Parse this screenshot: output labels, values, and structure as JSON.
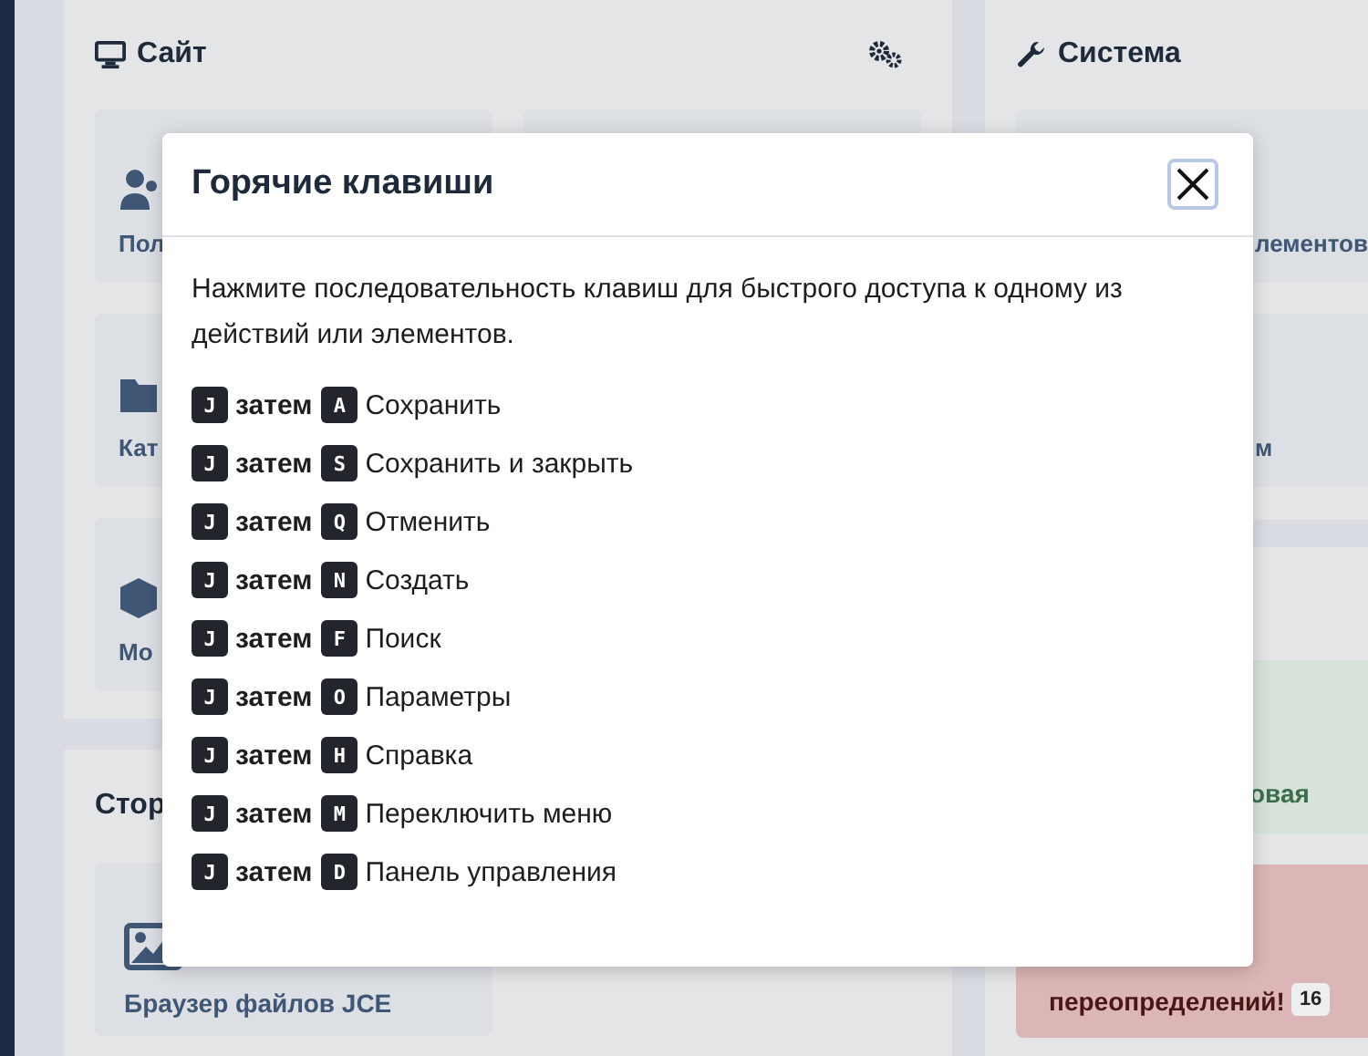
{
  "dashboard": {
    "site_panel": {
      "title": "Сайт",
      "cards": [
        {
          "kind": "users",
          "label": "Пол"
        },
        {
          "kind": "folder",
          "label": "Кат"
        },
        {
          "kind": "cube",
          "label": "Мо"
        }
      ]
    },
    "storage_panel": {
      "title": "Стор",
      "cards": [
        {
          "kind": "image",
          "label": "Браузер файлов JCE"
        }
      ]
    },
    "system_panel": {
      "title": "Система",
      "cards": [
        "лементов",
        "м"
      ]
    },
    "status_cards": [
      {
        "kind": "success",
        "text": "овая"
      },
      {
        "kind": "danger",
        "text": "переопределений!",
        "badge": "16"
      }
    ]
  },
  "modal": {
    "title": "Горячие клавиши",
    "intro": "Нажмите последовательность клавиш для быстрого доступа к одному из действий или элементов.",
    "shortcuts": [
      {
        "first": "J",
        "then": "затем",
        "key": "A",
        "action": "Сохранить"
      },
      {
        "first": "J",
        "then": "затем",
        "key": "S",
        "action": "Сохранить и закрыть"
      },
      {
        "first": "J",
        "then": "затем",
        "key": "Q",
        "action": "Отменить"
      },
      {
        "first": "J",
        "then": "затем",
        "key": "N",
        "action": "Создать"
      },
      {
        "first": "J",
        "then": "затем",
        "key": "F",
        "action": "Поиск"
      },
      {
        "first": "J",
        "then": "затем",
        "key": "O",
        "action": "Параметры"
      },
      {
        "first": "J",
        "then": "затем",
        "key": "H",
        "action": "Справка"
      },
      {
        "first": "J",
        "then": "затем",
        "key": "M",
        "action": "Переключить меню"
      },
      {
        "first": "J",
        "then": "затем",
        "key": "D",
        "action": "Панель управления"
      }
    ]
  }
}
